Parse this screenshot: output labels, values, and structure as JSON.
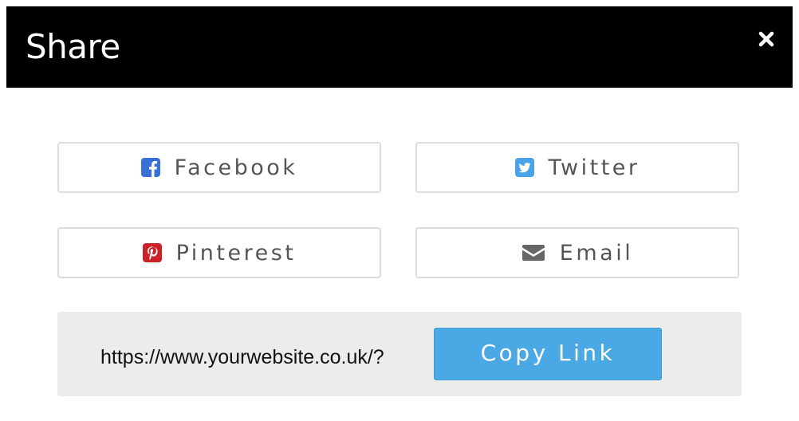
{
  "dialog": {
    "title": "Share"
  },
  "colors": {
    "header_bg": "#000000",
    "facebook": "#3b6fd8",
    "twitter": "#4aa3e8",
    "pinterest": "#cc2127",
    "email_icon": "#666666",
    "copy_button": "#4aa8e5",
    "link_box_bg": "#ececec"
  },
  "share_buttons": [
    {
      "label": "Facebook",
      "icon": "facebook-icon"
    },
    {
      "label": "Twitter",
      "icon": "twitter-icon"
    },
    {
      "label": "Pinterest",
      "icon": "pinterest-icon"
    },
    {
      "label": "Email",
      "icon": "envelope-icon"
    }
  ],
  "link": {
    "url": "https://www.yourwebsite.co.uk/?",
    "copy_label": "Copy Link"
  }
}
